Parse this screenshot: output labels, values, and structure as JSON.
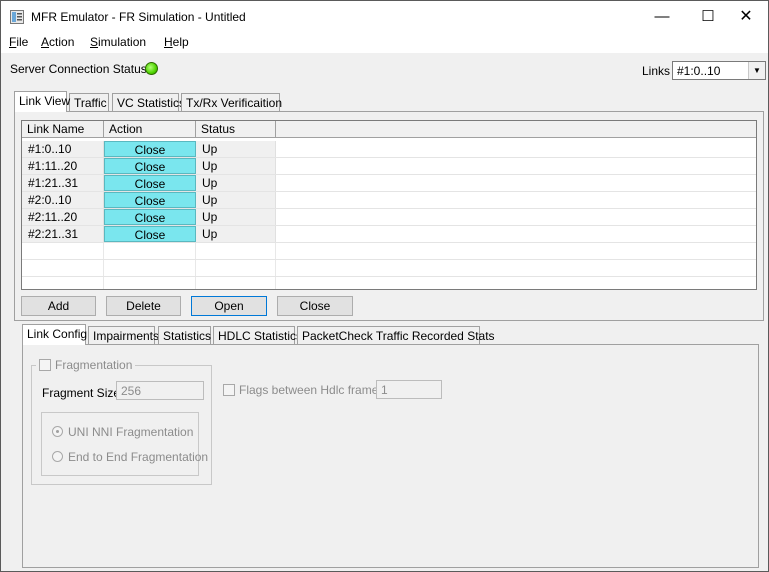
{
  "window": {
    "title": "MFR Emulator - FR Simulation - Untitled",
    "minimize_glyph": "—",
    "maximize_glyph": "☐",
    "close_glyph": "✕"
  },
  "menu": [
    "File",
    "Action",
    "Simulation",
    "Help"
  ],
  "server": {
    "label": "Server Connection Status",
    "status_color": "#4fd400"
  },
  "links": {
    "label": "Links",
    "selected": "#1:0..10"
  },
  "top_tabs": [
    "Link View",
    "Traffic",
    "VC Statistics",
    "Tx/Rx Verificaition"
  ],
  "table": {
    "headers": [
      "Link Name",
      "Action",
      "Status"
    ],
    "rows": [
      {
        "name": "#1:0..10",
        "action": "Close",
        "status": "Up"
      },
      {
        "name": "#1:11..20",
        "action": "Close",
        "status": "Up"
      },
      {
        "name": "#1:21..31",
        "action": "Close",
        "status": "Up"
      },
      {
        "name": "#2:0..10",
        "action": "Close",
        "status": "Up"
      },
      {
        "name": "#2:11..20",
        "action": "Close",
        "status": "Up"
      },
      {
        "name": "#2:21..31",
        "action": "Close",
        "status": "Up"
      }
    ],
    "action_color": "#7ae6ee"
  },
  "buttons": {
    "add": "Add",
    "delete": "Delete",
    "open": "Open",
    "close": "Close"
  },
  "bottom_tabs": [
    "Link Config",
    "Impairments",
    "Statistics",
    "HDLC Statistics",
    "PacketCheck Traffic Recorded Stats"
  ],
  "link_config": {
    "fragmentation_label": "Fragmentation",
    "fragment_size_label": "Fragment Size",
    "fragment_size_value": "256",
    "flags_label": "Flags between Hdlc frames",
    "flags_value": "1",
    "uni_nni_label": "UNI NNI Fragmentation",
    "end_to_end_label": "End to End Fragmentation"
  }
}
